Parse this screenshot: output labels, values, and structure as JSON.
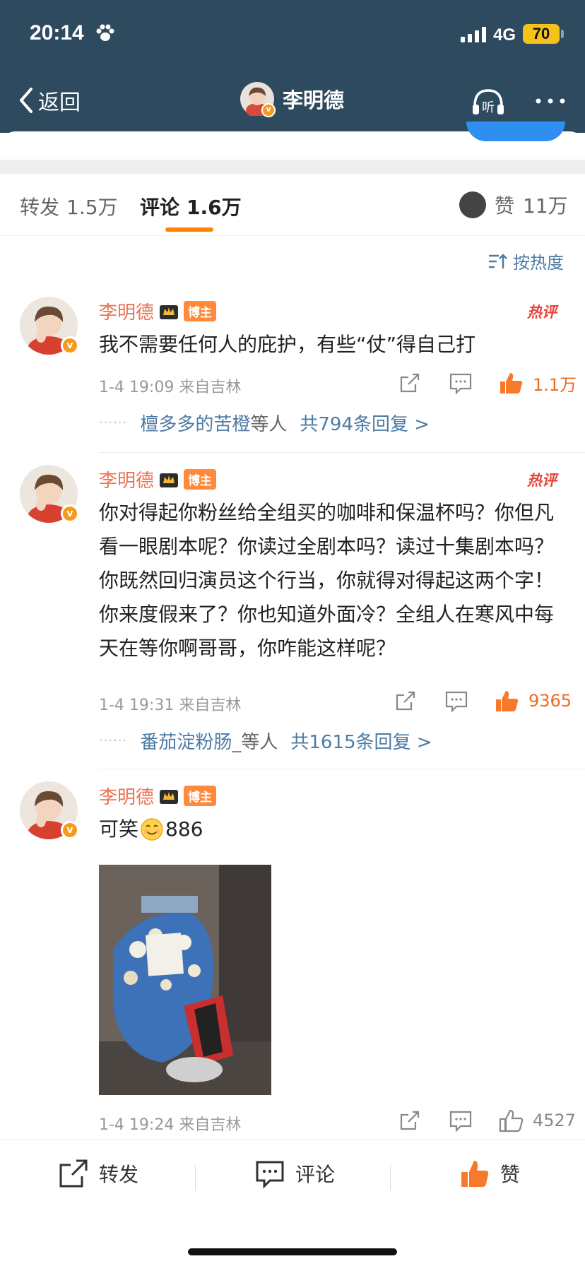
{
  "status_bar": {
    "time": "20:14",
    "network": "4G",
    "battery": "70"
  },
  "nav": {
    "back_label": "返回",
    "title": "李明德"
  },
  "tabs": {
    "repost": {
      "label": "转发",
      "count": "1.5万"
    },
    "comment": {
      "label": "评论",
      "count": "1.6万"
    },
    "like": {
      "label": "赞",
      "count": "11万"
    }
  },
  "sort_label": "按热度",
  "comments": [
    {
      "name": "李明德",
      "badge": "博主",
      "hot": "热评",
      "text": "我不需要任何人的庇护，有些“仗”得自己打",
      "time": "1-4 19:09",
      "source": "来自吉林",
      "likes": "1.1万",
      "reply_user": "檀多多的苦橙",
      "reply_mid": "等人",
      "reply_count": "共794条回复 >"
    },
    {
      "name": "李明德",
      "badge": "博主",
      "hot": "热评",
      "text": "你对得起你粉丝给全组买的咖啡和保温杯吗？你但凡看一眼剧本呢？你读过全剧本吗？读过十集剧本吗？你既然回归演员这个行当，你就得对得起这两个字！你来度假来了？你也知道外面冷？全组人在寒风中每天在等你啊哥哥，你咋能这样呢？",
      "time": "1-4 19:31",
      "source": "来自吉林",
      "likes": "9365",
      "reply_user": "番茄淀粉肠_",
      "reply_mid": "等人",
      "reply_count": "共1615条回复 >"
    },
    {
      "name": "李明德",
      "badge": "博主",
      "text_prefix": "可笑",
      "text_suffix": "886",
      "time": "1-4 19:24",
      "source": "来自吉林",
      "likes": "4527"
    }
  ],
  "bottom_bar": {
    "repost": "转发",
    "comment": "评论",
    "like": "赞"
  },
  "colors": {
    "header": "#2e4a5e",
    "accent": "#ff8200",
    "name": "#eb7350",
    "link": "#4e7ba3",
    "hot": "#e8433a"
  }
}
